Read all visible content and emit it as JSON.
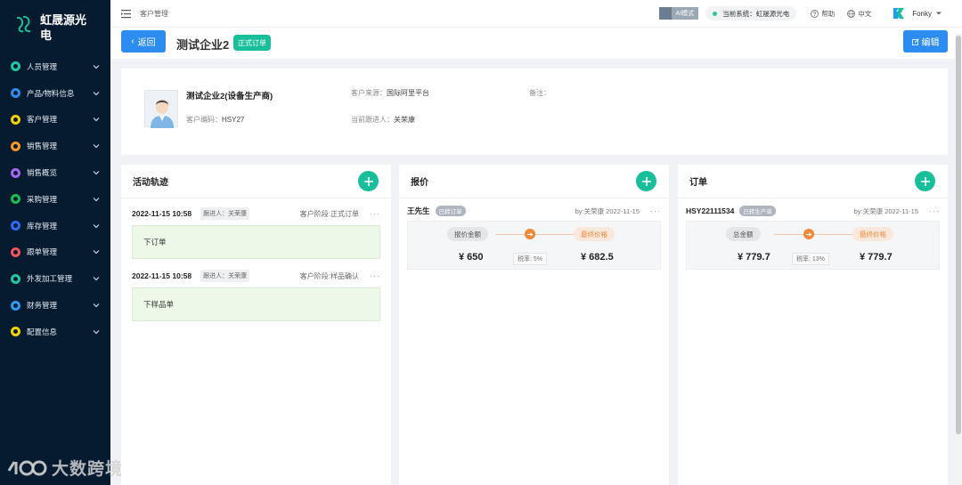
{
  "brand": {
    "name": "虹晟源光电"
  },
  "sidebar": {
    "items": [
      {
        "label": "人员管理",
        "color": "#1fc7a4"
      },
      {
        "label": "产品/物料信息",
        "color": "#2d8cf0"
      },
      {
        "label": "客户管理",
        "color": "#f5d300"
      },
      {
        "label": "销售管理",
        "color": "#f59a23"
      },
      {
        "label": "销售概览",
        "color": "#a566f0"
      },
      {
        "label": "采购管理",
        "color": "#19be4f"
      },
      {
        "label": "库存管理",
        "color": "#2d6bf0"
      },
      {
        "label": "跟单管理",
        "color": "#f0555a"
      },
      {
        "label": "外发加工管理",
        "color": "#1fc7a4"
      },
      {
        "label": "财务管理",
        "color": "#2d9cf0"
      },
      {
        "label": "配置信息",
        "color": "#f5d300"
      }
    ]
  },
  "topbar": {
    "breadcrumb": "客户管理",
    "ai_mode": "AI模式",
    "system": "当前系统：虹晟源光电",
    "help": "帮助",
    "language": "中文",
    "user": "Fonky"
  },
  "titlebar": {
    "back": "返回",
    "title": "测试企业2",
    "status": "正式订单",
    "edit": "编辑"
  },
  "customer": {
    "name": "测试企业2(设备生产商)",
    "code_label": "客户编码：",
    "code": "HSY27",
    "source_label": "客户来源：",
    "source": "国际阿里平台",
    "owner_label": "当前跟进人：",
    "owner": "关荣康",
    "remark_label": "备注："
  },
  "activities": {
    "title": "活动轨迹",
    "items": [
      {
        "time": "2022-11-15 10:58",
        "follower": "跟进人：关荣康",
        "stage": "客户阶段:正式订单",
        "content": "下订单"
      },
      {
        "time": "2022-11-15 10:58",
        "follower": "跟进人：关荣康",
        "stage": "客户阶段:样品确认",
        "content": "下样品单"
      }
    ]
  },
  "quote": {
    "title": "报价",
    "name": "王先生",
    "tag": "已转订单",
    "meta": "by:关荣康   2022-11-15",
    "left_label": "报价金额",
    "right_label": "最终价格",
    "left_value": "¥ 650",
    "rate": "税率: 5%",
    "right_value": "¥ 682.5"
  },
  "order": {
    "title": "订单",
    "name": "HSY22111534",
    "tag": "已转生产单",
    "meta": "by:关荣康   2022-11-15",
    "left_label": "总金额",
    "right_label": "最终价格",
    "left_value": "¥ 779.7",
    "rate": "税率: 13%",
    "right_value": "¥ 779.7"
  },
  "watermark": "大数跨境"
}
